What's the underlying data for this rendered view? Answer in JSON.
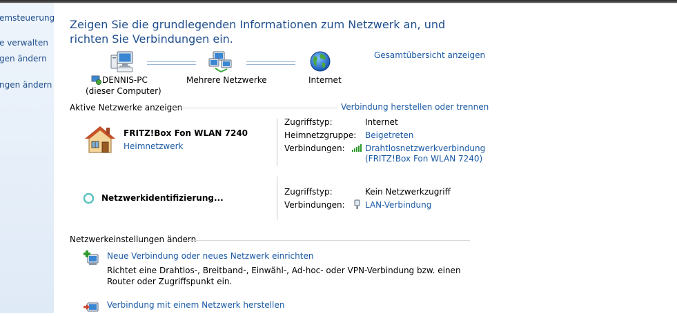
{
  "sidebar": {
    "items": [
      "emsteuerung",
      "e verwalten",
      "gen ändern",
      "ngen ändern"
    ]
  },
  "header": {
    "title": "Zeigen Sie die grundlegenden Informationen zum Netzwerk an, und richten Sie Verbindungen ein.",
    "full_map_link": "Gesamtübersicht anzeigen"
  },
  "network_map": {
    "computer_name": "DENNIS-PC",
    "computer_sub": "(dieser Computer)",
    "middle": "Mehrere Netzwerke",
    "internet": "Internet"
  },
  "active_networks": {
    "section_title": "Aktive Netzwerke anzeigen",
    "connect_link": "Verbindung herstellen oder trennen",
    "network1": {
      "name": "FRITZ!Box Fon WLAN 7240",
      "type_link": "Heimnetzwerk",
      "access_label": "Zugriffstyp:",
      "access_value": "Internet",
      "homegroup_label": "Heimnetzgruppe:",
      "homegroup_value": "Beigetreten",
      "connections_label": "Verbindungen:",
      "connection_line1": "Drahtlosnetzwerkverbindung",
      "connection_line2": "(FRITZ!Box Fon WLAN 7240)"
    },
    "network2": {
      "name": "Netzwerkidentifizierung...",
      "access_label": "Zugriffstyp:",
      "access_value": "Kein Netzwerkzugriff",
      "connections_label": "Verbindungen:",
      "connection": "LAN-Verbindung"
    }
  },
  "settings": {
    "section_title": "Netzwerkeinstellungen ändern",
    "item1_link": "Neue Verbindung oder neues Netzwerk einrichten",
    "item1_desc": "Richtet eine Drahtlos-, Breitband-, Einwähl-, Ad-hoc- oder VPN-Verbindung bzw. einen Router oder Zugriffspunkt ein.",
    "item2_link": "Verbindung mit einem Netzwerk herstellen"
  }
}
